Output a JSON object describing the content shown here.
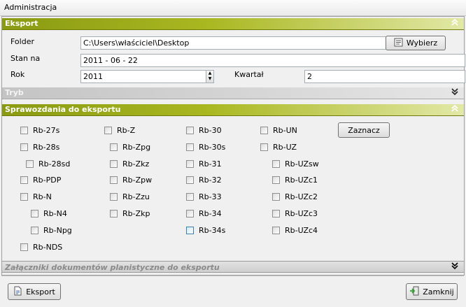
{
  "window": {
    "title": "Administracja"
  },
  "sections": {
    "eksport": {
      "title": "Eksport",
      "chevron": "double-up-icon"
    },
    "tryb": {
      "title": "Tryb",
      "chevron": "double-down-icon"
    },
    "sprawozdania": {
      "title": "Sprawozdania do eksportu",
      "chevron": "double-up-icon"
    },
    "zalaczniki": {
      "title": "Załączniki dokumentów planistyczne do eksportu",
      "chevron": "double-down-icon"
    }
  },
  "form": {
    "folder_label": "Folder",
    "folder_value": "C:\\Users\\właściciel\\Desktop",
    "wybierz_label": "Wybierz",
    "stan_label": "Stan na",
    "stan_value": "2011 - 06 - 22",
    "rok_label": "Rok",
    "rok_value": "2011",
    "kwartal_label": "Kwartał",
    "kwartal_value": "2"
  },
  "reports": {
    "zaznacz_label": "Zaznacz",
    "col1": [
      "Rb-27s",
      "Rb-28s",
      "Rb-28sd",
      "Rb-PDP",
      "Rb-N",
      "Rb-N4",
      "Rb-Npg",
      "Rb-NDS"
    ],
    "col2": [
      "Rb-Z",
      "Rb-Zpg",
      "Rb-Zkz",
      "Rb-Zpw",
      "Rb-Zzu",
      "Rb-Zkp"
    ],
    "col3": [
      "Rb-30",
      "Rb-30s",
      "Rb-31",
      "Rb-32",
      "Rb-33",
      "Rb-34",
      "Rb-34s"
    ],
    "col4": [
      "Rb-UN",
      "Rb-UZ",
      "Rb-UZsw",
      "Rb-UZc1",
      "Rb-UZc2",
      "Rb-UZc3",
      "Rb-UZc4"
    ]
  },
  "footer": {
    "eksport_label": "Eksport",
    "zamknij_label": "Zamknij"
  }
}
